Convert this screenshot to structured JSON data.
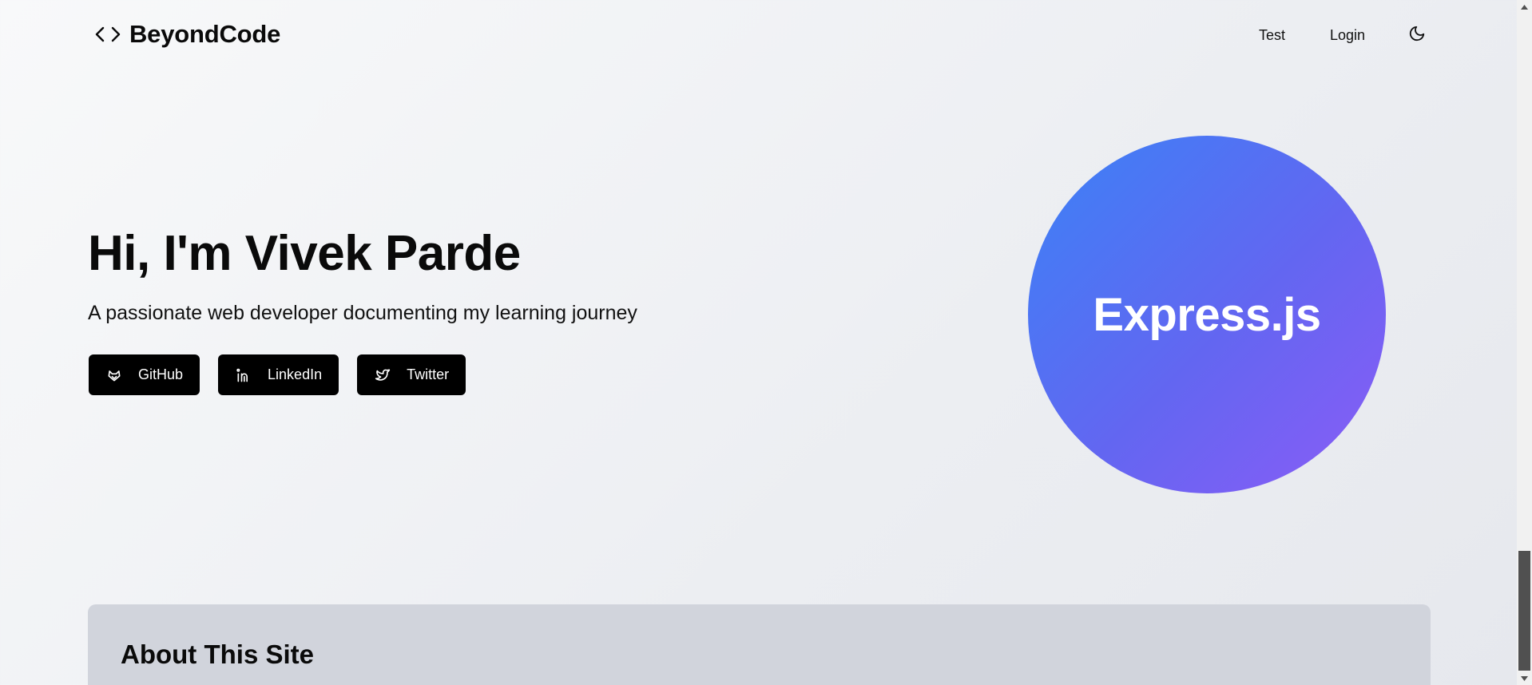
{
  "header": {
    "brand_name": "BeyondCode",
    "nav": [
      {
        "label": "Test"
      },
      {
        "label": "Login"
      }
    ]
  },
  "hero": {
    "title": "Hi, I'm Vivek Parde",
    "subtitle": "A passionate web developer documenting my learning journey",
    "socials": [
      {
        "label": "GitHub",
        "icon": "github-icon"
      },
      {
        "label": "LinkedIn",
        "icon": "linkedin-icon"
      },
      {
        "label": "Twitter",
        "icon": "twitter-icon"
      }
    ],
    "circle_label": "Express.js",
    "circle_colors": [
      "#3b82f6",
      "#8b5cf6"
    ]
  },
  "about": {
    "title": "About This Site"
  }
}
